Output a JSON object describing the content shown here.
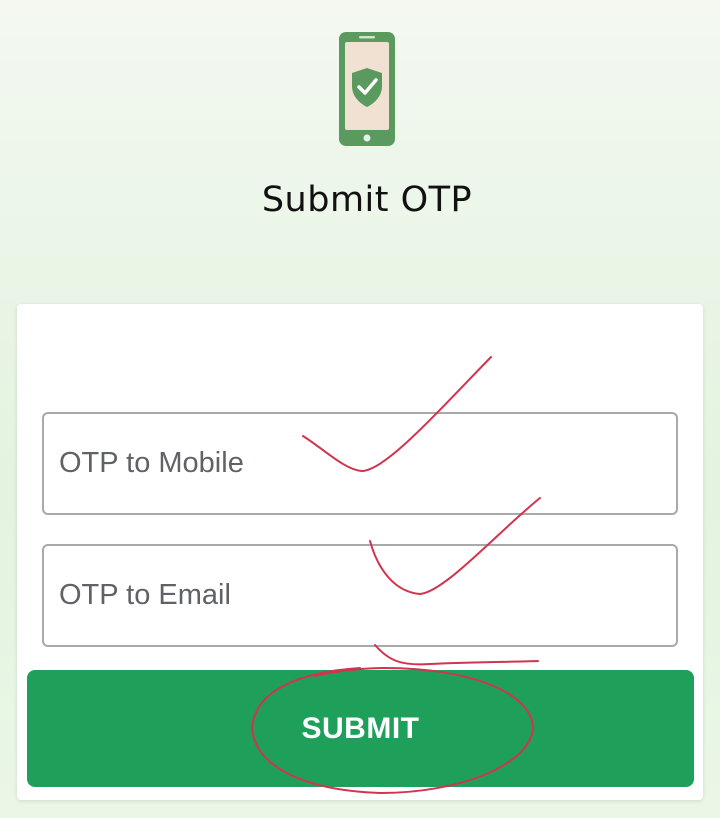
{
  "header": {
    "icon": "phone-shield-check-icon",
    "title": "Submit OTP"
  },
  "form": {
    "mobile_placeholder": "OTP to Mobile",
    "email_placeholder": "OTP to Email",
    "submit_label": "SUBMIT"
  },
  "colors": {
    "accent": "#1fa05a",
    "icon_green": "#5a9a5e",
    "annotation_red": "#d0344f"
  }
}
